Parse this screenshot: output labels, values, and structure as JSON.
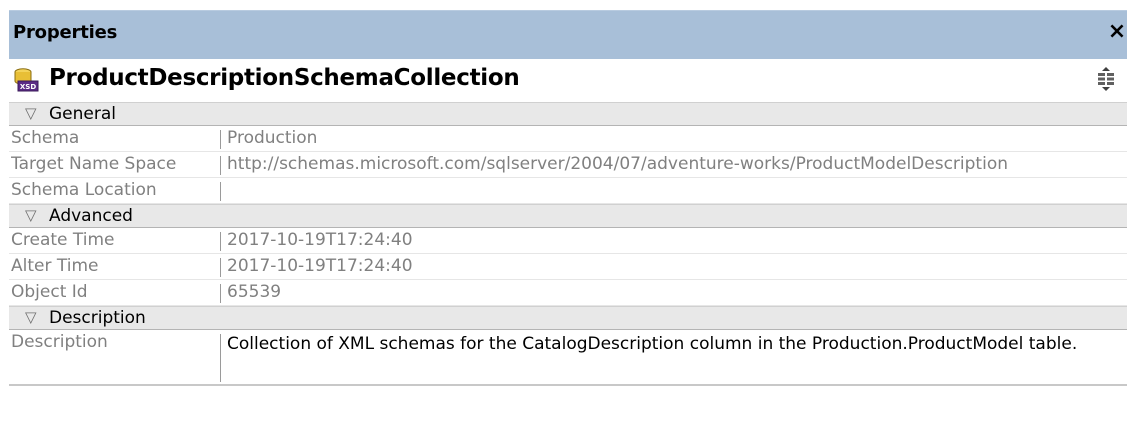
{
  "panel": {
    "title": "Properties",
    "close_glyph": "×"
  },
  "object": {
    "name": "ProductDescriptionSchemaCollection",
    "icon": "xsd-schema-collection-icon"
  },
  "sections": {
    "general": {
      "label": "General",
      "rows": [
        {
          "name": "Schema",
          "value": "Production"
        },
        {
          "name": "Target Name Space",
          "value": "http://schemas.microsoft.com/sqlserver/2004/07/adventure-works/ProductModelDescription"
        },
        {
          "name": "Schema Location",
          "value": ""
        }
      ]
    },
    "advanced": {
      "label": "Advanced",
      "rows": [
        {
          "name": "Create Time",
          "value": "2017-10-19T17:24:40"
        },
        {
          "name": "Alter Time",
          "value": "2017-10-19T17:24:40"
        },
        {
          "name": "Object Id",
          "value": "65539"
        }
      ]
    },
    "description": {
      "label": "Description",
      "rows": [
        {
          "name": "Description",
          "value": "Collection of XML schemas for the CatalogDescription column in the Production.ProductModel table."
        }
      ]
    }
  },
  "colors": {
    "titlebar": "#a8bfd8",
    "section_bg": "#e8e8e8",
    "label_gray": "#808080"
  }
}
